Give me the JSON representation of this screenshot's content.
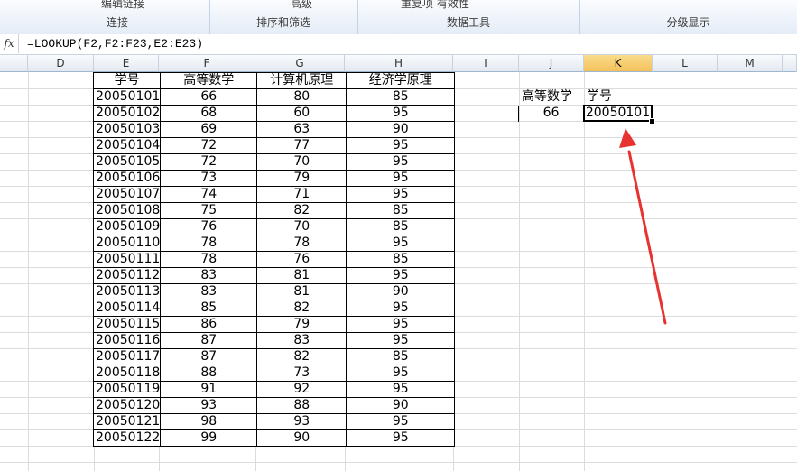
{
  "ribbon": {
    "cut_text_left": "编辑链接",
    "cut_text_mid": "高级",
    "cut_text_right": "重复项  有效性",
    "groups": [
      "连接",
      "排序和筛选",
      "数据工具",
      "分级显示"
    ]
  },
  "formula_bar": {
    "fx": "fx",
    "formula": "=LOOKUP(F2,F2:F23,E2:E23)"
  },
  "columns": [
    "D",
    "E",
    "F",
    "G",
    "H",
    "I",
    "J",
    "K",
    "L",
    "M"
  ],
  "table": {
    "headers": [
      "学号",
      "高等数学",
      "计算机原理",
      "经济学原理"
    ],
    "rows": [
      [
        "20050101",
        "66",
        "80",
        "85"
      ],
      [
        "20050102",
        "68",
        "60",
        "95"
      ],
      [
        "20050103",
        "69",
        "63",
        "90"
      ],
      [
        "20050104",
        "72",
        "77",
        "95"
      ],
      [
        "20050105",
        "72",
        "70",
        "95"
      ],
      [
        "20050106",
        "73",
        "79",
        "95"
      ],
      [
        "20050107",
        "74",
        "71",
        "95"
      ],
      [
        "20050108",
        "75",
        "82",
        "85"
      ],
      [
        "20050109",
        "76",
        "70",
        "85"
      ],
      [
        "20050110",
        "78",
        "78",
        "95"
      ],
      [
        "20050111",
        "78",
        "76",
        "85"
      ],
      [
        "20050112",
        "83",
        "81",
        "95"
      ],
      [
        "20050113",
        "83",
        "81",
        "90"
      ],
      [
        "20050114",
        "85",
        "82",
        "95"
      ],
      [
        "20050115",
        "86",
        "79",
        "95"
      ],
      [
        "20050116",
        "87",
        "83",
        "95"
      ],
      [
        "20050117",
        "87",
        "82",
        "85"
      ],
      [
        "20050118",
        "88",
        "73",
        "95"
      ],
      [
        "20050119",
        "91",
        "92",
        "95"
      ],
      [
        "20050120",
        "93",
        "88",
        "90"
      ],
      [
        "20050121",
        "98",
        "93",
        "95"
      ],
      [
        "20050122",
        "99",
        "90",
        "95"
      ]
    ]
  },
  "lookup": {
    "label_math": "高等数学",
    "label_id": "学号",
    "math_value": "66",
    "result_value": "20050101"
  },
  "colors": {
    "arrow": "#e8322f",
    "active_header": "#f3c15a"
  }
}
